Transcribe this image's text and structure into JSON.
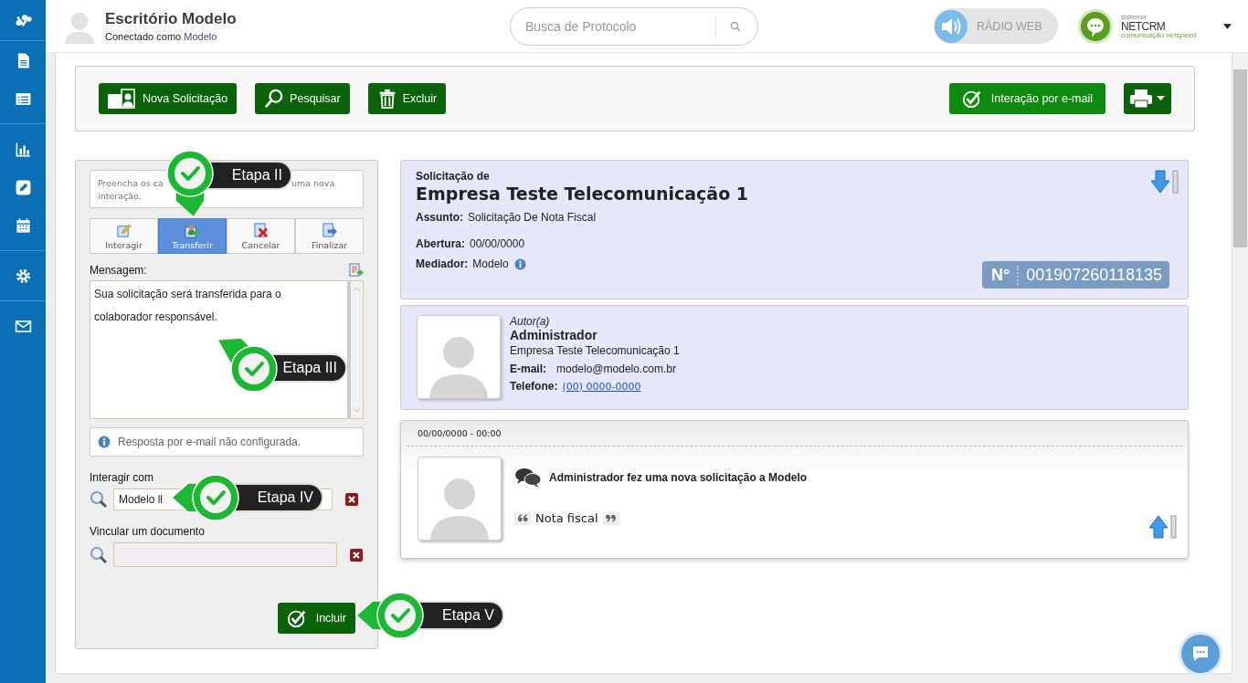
{
  "header": {
    "title": "Escritório Modelo",
    "subtitle_prefix": "Conectado como",
    "subtitle_user": "Modelo",
    "search": {
      "placeholder": "Busca de Protocolo"
    },
    "radio": {
      "label": "RÁDIO WEB",
      "on": false
    },
    "brand": {
      "small": "sistema",
      "name": "NETCRM",
      "tagline": "comunicação netspeed"
    }
  },
  "toolbar": {
    "buttons": [
      {
        "label": "Nova Solicitação",
        "kind": "new"
      },
      {
        "label": "Pesquisar",
        "kind": "search"
      },
      {
        "label": "Excluir",
        "kind": "delete"
      }
    ],
    "right_buttons": [
      {
        "label": "Interação por e-mail",
        "kind": "email"
      },
      {
        "kind": "print"
      }
    ]
  },
  "form": {
    "hint_parts": [
      "Preencha os ca",
      "uma nova",
      "interação."
    ],
    "tabs": [
      {
        "label": "Interagir",
        "kind": "edit",
        "selected": false
      },
      {
        "label": "Transferir",
        "kind": "transfer",
        "selected": true
      },
      {
        "label": "Cancelar",
        "kind": "cancel",
        "selected": false
      },
      {
        "label": "Finalizar",
        "kind": "finish",
        "selected": false
      }
    ],
    "message_label": "Mensagem:",
    "message": "Sua solicitação será transferida para o colaborador responsável.",
    "email_notice": "Resposta por e-mail não configurada.",
    "interact_label": "Interagir com",
    "interact_value": "Modelo ll",
    "document_label": "Vincular um documento",
    "submit": "Incluir"
  },
  "steps": [
    {
      "label": "Etapa II"
    },
    {
      "label": "Etapa III"
    },
    {
      "label": "Etapa IV"
    },
    {
      "label": "Etapa V"
    }
  ],
  "request": {
    "heading": "Solicitação de",
    "company": "Empresa Teste Telecomunicação 1",
    "fields": [
      {
        "label": "Assunto:",
        "value": "Solicitação De Nota Fiscal"
      },
      {
        "label": "Abertura:",
        "value": "00/00/0000"
      },
      {
        "label": "Mediador:",
        "value": "Modelo"
      }
    ],
    "number_label": "N°",
    "number": "001907260118135"
  },
  "author": {
    "role": "Autor(a)",
    "name": "Administrador",
    "company": "Empresa Teste Telecomunicação 1",
    "email_label": "E-mail:",
    "email": "modelo@modelo.com.br",
    "phone_label": "Telefone:",
    "phone": "(00) 0000-0000"
  },
  "timeline": [
    {
      "time": "00/00/0000 - 00:00",
      "message": "Administrador fez uma nova solicitação a Modelo",
      "quote": "Nota fiscal"
    }
  ]
}
